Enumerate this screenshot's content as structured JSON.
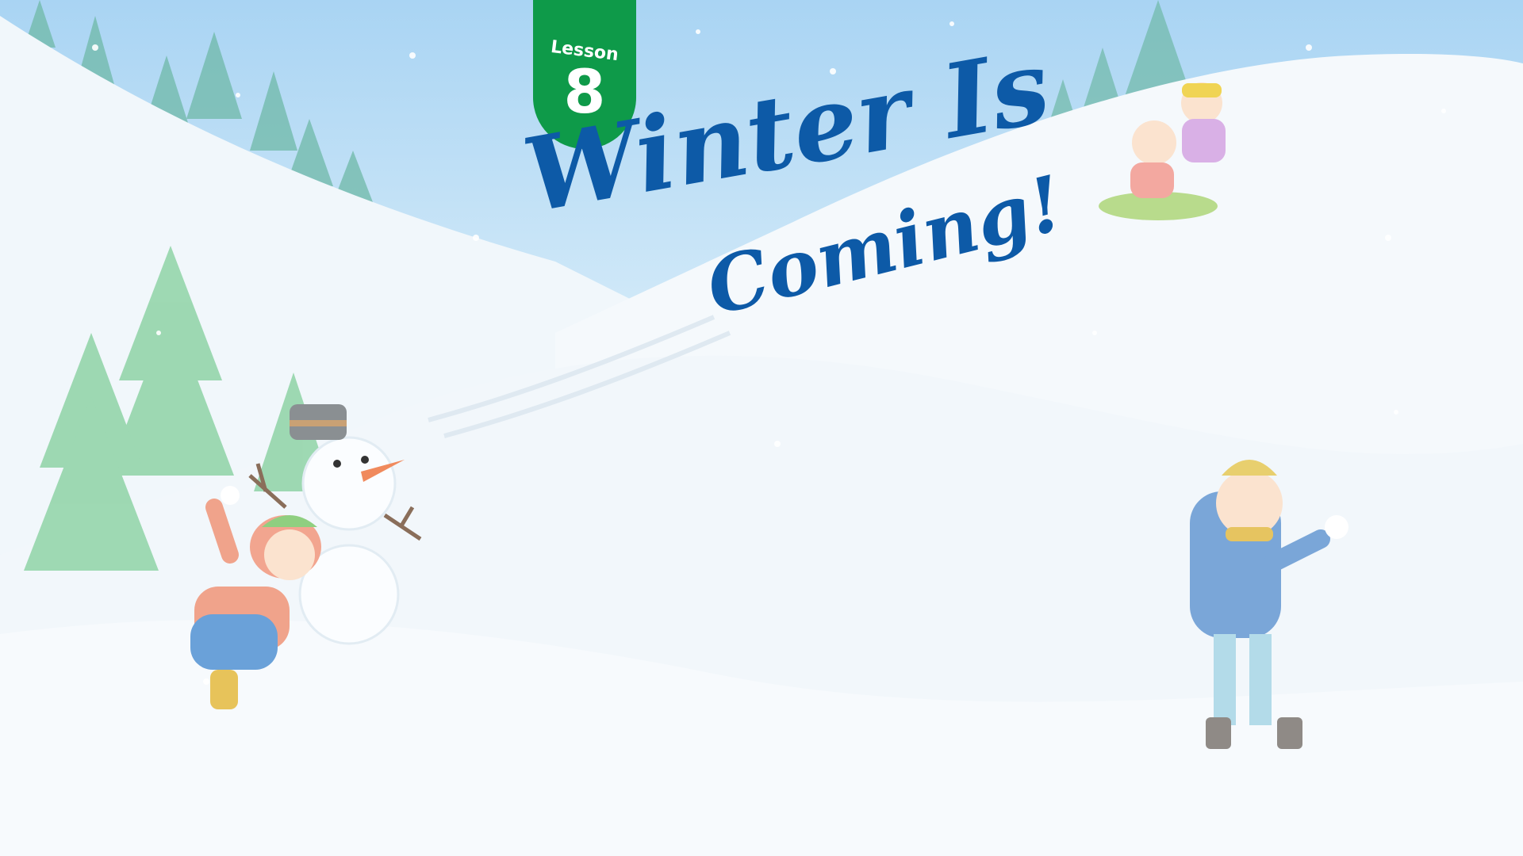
{
  "lesson": {
    "label": "Lesson",
    "number": "8",
    "color": "#0e9a49"
  },
  "title": {
    "line1": "Winter Is",
    "line2": "Coming!",
    "color": "#0d5aa7"
  },
  "scene": {
    "setting": "snowy hillside",
    "illustrations": [
      "pine-trees",
      "snowman",
      "girl-with-snowball",
      "kids-sledding",
      "boy-with-snowball",
      "snowflakes"
    ]
  }
}
